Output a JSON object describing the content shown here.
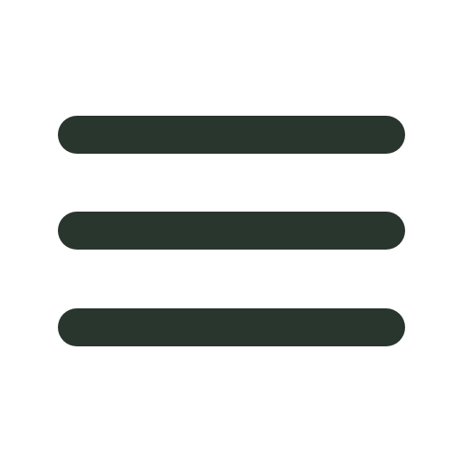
{
  "icon": {
    "name": "hamburger-menu-icon",
    "color": "#29362e",
    "background": "#ffffff"
  }
}
